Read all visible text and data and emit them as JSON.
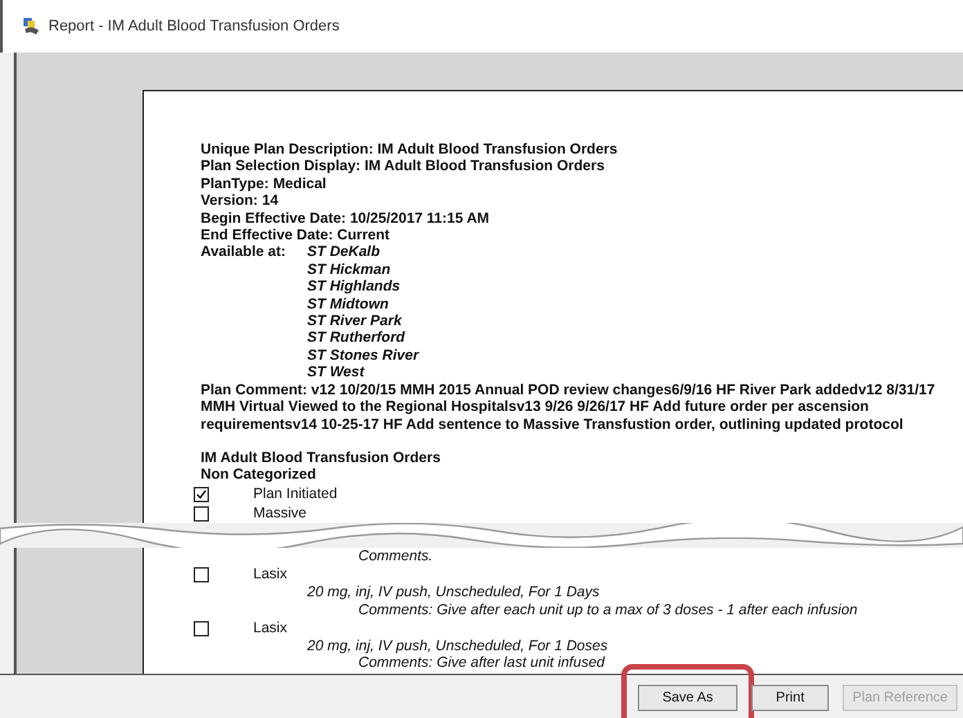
{
  "window": {
    "title": "Report - IM Adult Blood Transfusion Orders"
  },
  "report": {
    "header_lines": [
      "Unique Plan Description: IM Adult Blood Transfusion Orders",
      "Plan Selection Display: IM Adult Blood Transfusion Orders",
      "PlanType: Medical",
      "Version: 14",
      "Begin Effective Date: 10/25/2017 11:15 AM",
      "End Effective Date: Current"
    ],
    "available_label": "Available at:",
    "sites": [
      "ST DeKalb",
      "ST Hickman",
      "ST Highlands",
      "ST Midtown",
      "ST River Park",
      "ST Rutherford",
      "ST Stones River",
      "ST West"
    ],
    "plan_comment": "Plan Comment: v12 10/20/15 MMH 2015 Annual POD review changes6/9/16 HF River Park addedv12 8/31/17 MMH Virtual Viewed to the Regional Hospitalsv13 9/26 9/26/17 HF Add future order per ascension requirementsv14 10-25-17 HF Add sentence to Massive Transfustion order, outlining updated protocol",
    "section_title": "IM Adult Blood Transfusion Orders",
    "category": "Non Categorized",
    "items_before_break": [
      {
        "label": "Plan Initiated",
        "checked": true
      },
      {
        "label": "Massive",
        "checked": false
      }
    ],
    "after_break_comment": "Comments.",
    "items_after_break": [
      {
        "label": "Lasix",
        "checked": false,
        "details": "20 mg, inj, IV push, Unscheduled, For 1 Days",
        "comments": "Comments: Give after each unit up to a max of 3 doses - 1 after each infusion"
      },
      {
        "label": "Lasix",
        "checked": false,
        "details": "20 mg, inj, IV push, Unscheduled, For 1 Doses",
        "comments": "Comments: Give after last unit infused"
      }
    ]
  },
  "buttons": [
    {
      "label": "Save As",
      "disabled": false,
      "highlighted": true
    },
    {
      "label": "Print",
      "disabled": false,
      "highlighted": false
    },
    {
      "label": "Plan Reference",
      "disabled": true,
      "highlighted": false
    }
  ]
}
